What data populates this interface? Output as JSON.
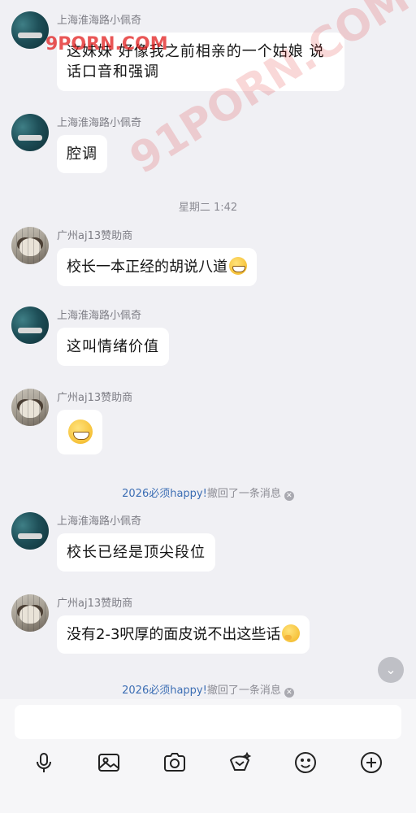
{
  "messages": [
    {
      "sender": "上海淮海路小佩奇",
      "avatar": "sea",
      "text": "这妹妹好像我之前相亲的一个姑娘 说话口音和强调",
      "line2": "话口音和强调",
      "line1": "这妹妹 好像我之前相亲的一个姑娘 说"
    },
    {
      "sender": "上海淮海路小佩奇",
      "avatar": "sea",
      "text": "腔调"
    },
    {
      "sender": "广州aj13赞助商",
      "avatar": "dog",
      "text": "校长一本正经的胡说八道",
      "emoji": "grinning-face"
    },
    {
      "sender": "上海淮海路小佩奇",
      "avatar": "sea",
      "text": "这叫情绪价值"
    },
    {
      "sender": "广州aj13赞助商",
      "avatar": "dog",
      "emoji": "grinning-face-large"
    },
    {
      "sender": "上海淮海路小佩奇",
      "avatar": "sea",
      "text": "校长已经是顶尖段位"
    },
    {
      "sender": "广州aj13赞助商",
      "avatar": "dog",
      "text": "没有2-3呎厚的面皮说不出这些话",
      "emoji": "face-with-hand-over-mouth"
    }
  ],
  "timestamp": "星期二 1:42",
  "recall_notices": [
    {
      "who": "2026必须happy!",
      "text": "撤回了一条消息"
    },
    {
      "who": "2026必须happy!",
      "text": "撤回了一条消息"
    }
  ],
  "watermarks": [
    "9PORN.COM",
    "91PORN.COM"
  ],
  "toolbar": [
    "microphone-icon",
    "image-icon",
    "camera-icon",
    "red-packet-icon",
    "emoji-icon",
    "plus-icon"
  ],
  "colors": {
    "background": "#f0f0f4",
    "bubble": "#ffffff",
    "link": "#3c6eb4",
    "meta": "#7d7d85"
  }
}
